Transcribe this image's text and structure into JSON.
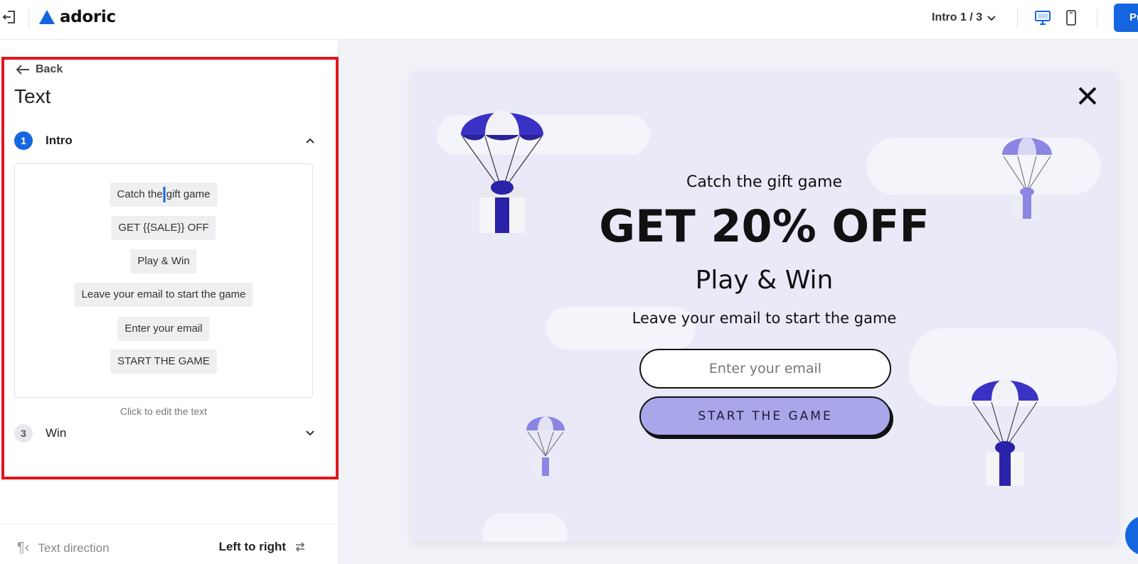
{
  "brand": {
    "name": "adoric",
    "accent": "#1565e0",
    "highlight": "#e0161e"
  },
  "topbar": {
    "step_selector": "Intro 1 / 3",
    "device_desktop_icon": "desktop-icon",
    "device_mobile_icon": "mobile-icon",
    "publish_label": "Pu"
  },
  "panel": {
    "back_label": "Back",
    "title": "Text",
    "sections": [
      {
        "number": "1",
        "label": "Intro",
        "expanded": true
      },
      {
        "number": "3",
        "label": "Win",
        "expanded": false
      }
    ],
    "text_items": [
      {
        "before_caret": "Catch the",
        "after_caret": "gift game"
      },
      {
        "text": "GET {{SALE}} OFF"
      },
      {
        "text": "Play & Win"
      },
      {
        "text": "Leave your email to start the game"
      },
      {
        "text": "Enter your email"
      },
      {
        "text": "START THE GAME"
      }
    ],
    "hint": "Click to edit the text",
    "footer": {
      "label": "Text direction",
      "value": "Left to right"
    }
  },
  "popup": {
    "subtitle": "Catch the gift game",
    "headline": "GET 20% OFF",
    "tagline": "Play & Win",
    "description": "Leave your email to start the game",
    "email_placeholder": "Enter your email",
    "cta": "START THE GAME",
    "background": "#e9e9f8",
    "button_color": "#a9a6ea"
  }
}
